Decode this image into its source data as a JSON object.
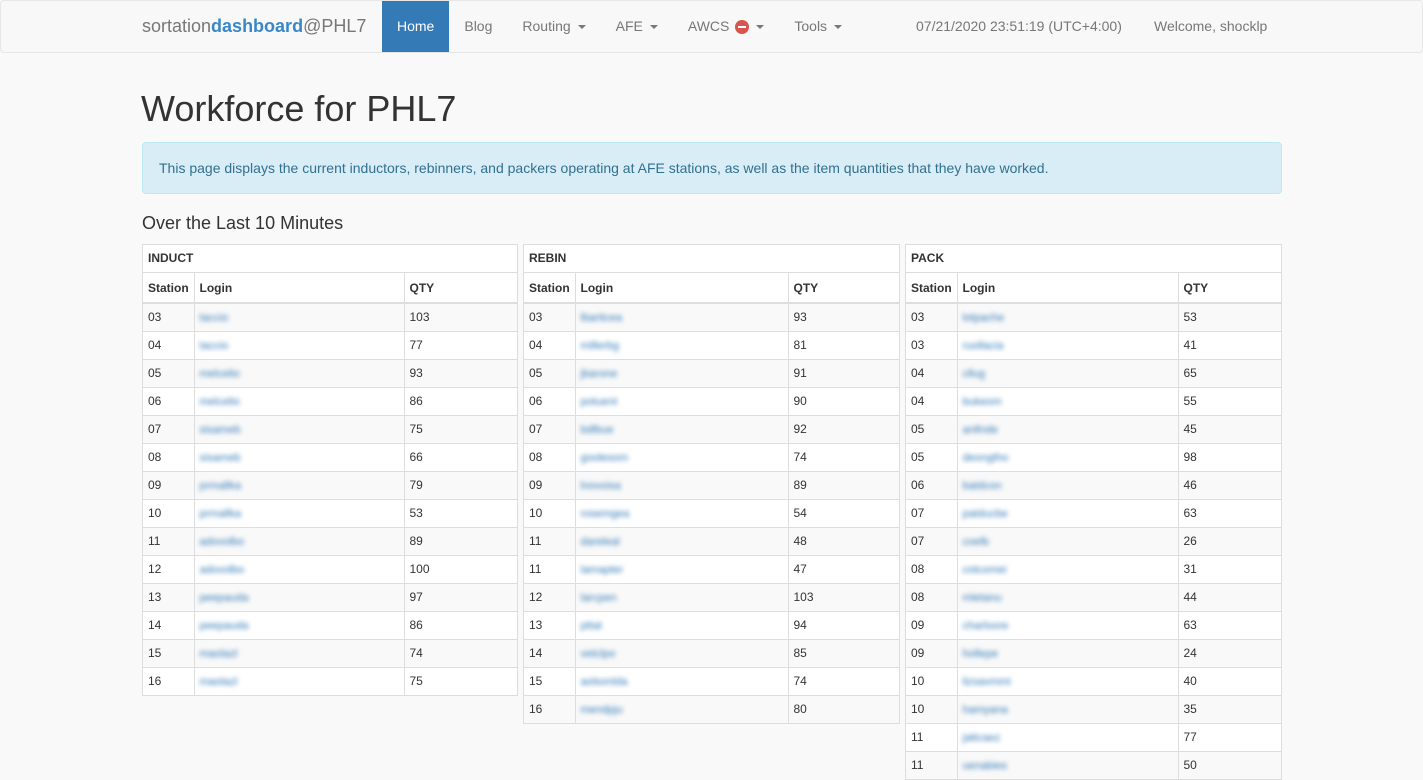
{
  "brand": {
    "part1": "sortation",
    "part2": "dashboard",
    "part3": "@PHL7"
  },
  "nav": {
    "home": "Home",
    "blog": "Blog",
    "routing": "Routing",
    "afe": "AFE",
    "awcs": "AWCS",
    "tools": "Tools",
    "datetime": "07/21/2020 23:51:19 (UTC+4:00)",
    "welcome": "Welcome, shocklp"
  },
  "page": {
    "title": "Workforce for PHL7",
    "info": "This page displays the current inductors, rebinners, and packers operating at AFE stations, as well as the item quantities that they have worked.",
    "section": "Over the Last 10 Minutes"
  },
  "columns": {
    "station": "Station",
    "login": "Login",
    "qty": "QTY"
  },
  "induct": {
    "title": "INDUCT",
    "rows": [
      {
        "station": "03",
        "login": "taccio",
        "qty": "103"
      },
      {
        "station": "04",
        "login": "taccio",
        "qty": "77"
      },
      {
        "station": "05",
        "login": "melcelio",
        "qty": "93"
      },
      {
        "station": "06",
        "login": "melcelio",
        "qty": "86"
      },
      {
        "station": "07",
        "login": "sisameb",
        "qty": "75"
      },
      {
        "station": "08",
        "login": "sisameb",
        "qty": "66"
      },
      {
        "station": "09",
        "login": "prmallka",
        "qty": "79"
      },
      {
        "station": "10",
        "login": "prmallka",
        "qty": "53"
      },
      {
        "station": "11",
        "login": "adovolbo",
        "qty": "89"
      },
      {
        "station": "12",
        "login": "adovolbo",
        "qty": "100"
      },
      {
        "station": "13",
        "login": "peepauda",
        "qty": "97"
      },
      {
        "station": "14",
        "login": "peepauda",
        "qty": "86"
      },
      {
        "station": "15",
        "login": "maolazl",
        "qty": "74"
      },
      {
        "station": "16",
        "login": "maolazl",
        "qty": "75"
      }
    ]
  },
  "rebin": {
    "title": "REBIN",
    "rows": [
      {
        "station": "03",
        "login": "lbaritcea",
        "qty": "93"
      },
      {
        "station": "04",
        "login": "millerbg",
        "qty": "81"
      },
      {
        "station": "05",
        "login": "jbarone",
        "qty": "91"
      },
      {
        "station": "06",
        "login": "potuent",
        "qty": "90"
      },
      {
        "station": "07",
        "login": "bdlbue",
        "qty": "92"
      },
      {
        "station": "08",
        "login": "goolesom",
        "qty": "74"
      },
      {
        "station": "09",
        "login": "lnovoisa",
        "qty": "89"
      },
      {
        "station": "10",
        "login": "rosemgea",
        "qty": "54"
      },
      {
        "station": "11",
        "login": "dareleal",
        "qty": "48"
      },
      {
        "station": "11",
        "login": "lamapter",
        "qty": "47"
      },
      {
        "station": "12",
        "login": "larcpen",
        "qty": "103"
      },
      {
        "station": "13",
        "login": "pttat",
        "qty": "94"
      },
      {
        "station": "14",
        "login": "vetclpo",
        "qty": "85"
      },
      {
        "station": "15",
        "login": "aolsonlda",
        "qty": "74"
      },
      {
        "station": "16",
        "login": "mendpju",
        "qty": "80"
      }
    ]
  },
  "pack": {
    "title": "PACK",
    "rows": [
      {
        "station": "03",
        "login": "lotpache",
        "qty": "53"
      },
      {
        "station": "03",
        "login": "ruollacia",
        "qty": "41"
      },
      {
        "station": "04",
        "login": "cllug",
        "qty": "65"
      },
      {
        "station": "04",
        "login": "bukeom",
        "qty": "55"
      },
      {
        "station": "05",
        "login": "anllnde",
        "qty": "45"
      },
      {
        "station": "05",
        "login": "deongtho",
        "qty": "98"
      },
      {
        "station": "06",
        "login": "batdcon",
        "qty": "46"
      },
      {
        "station": "07",
        "login": "patducbe",
        "qty": "63"
      },
      {
        "station": "07",
        "login": "coelb",
        "qty": "26"
      },
      {
        "station": "08",
        "login": "cotcomei",
        "qty": "31"
      },
      {
        "station": "08",
        "login": "mletanu",
        "qty": "44"
      },
      {
        "station": "09",
        "login": "charloore",
        "qty": "63"
      },
      {
        "station": "09",
        "login": "hollepe",
        "qty": "24"
      },
      {
        "station": "10",
        "login": "lizsavmmi",
        "qty": "40"
      },
      {
        "station": "10",
        "login": "hamyana",
        "qty": "35"
      },
      {
        "station": "11",
        "login": "jattcaez",
        "qty": "77"
      },
      {
        "station": "11",
        "login": "uenabies",
        "qty": "50"
      }
    ]
  }
}
